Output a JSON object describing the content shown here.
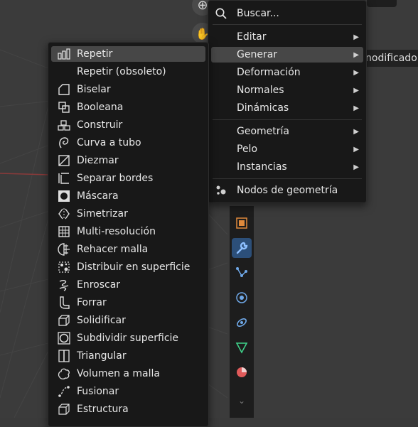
{
  "viewport": {
    "modifier_label": "nodificador"
  },
  "main_menu": {
    "search": {
      "label": "Buscar...",
      "icon": "search-icon"
    },
    "items": [
      {
        "label": "Editar",
        "submenu": true
      },
      {
        "label": "Generar",
        "submenu": true,
        "active": true
      },
      {
        "label": "Deformación",
        "submenu": true
      },
      {
        "label": "Normales",
        "submenu": true
      },
      {
        "label": "Dinámicas",
        "submenu": true
      }
    ],
    "items2": [
      {
        "label": "Geometría",
        "submenu": true
      },
      {
        "label": "Pelo",
        "submenu": true
      },
      {
        "label": "Instancias",
        "submenu": true
      }
    ],
    "nodes": {
      "label": "Nodos de geometría",
      "icon": "geometry-nodes-icon"
    }
  },
  "generate_menu": {
    "items": [
      {
        "label": "Repetir",
        "icon": "array-icon",
        "active": true
      },
      {
        "label": "Repetir (obsoleto)",
        "icon": ""
      },
      {
        "label": "Biselar",
        "icon": "bevel-icon"
      },
      {
        "label": "Booleana",
        "icon": "boolean-icon"
      },
      {
        "label": "Construir",
        "icon": "build-icon"
      },
      {
        "label": "Curva a tubo",
        "icon": "curve-to-tube-icon"
      },
      {
        "label": "Diezmar",
        "icon": "decimate-icon"
      },
      {
        "label": "Separar bordes",
        "icon": "edge-split-icon"
      },
      {
        "label": "Máscara",
        "icon": "mask-icon"
      },
      {
        "label": "Simetrizar",
        "icon": "mirror-icon"
      },
      {
        "label": "Multi-resolución",
        "icon": "multires-icon"
      },
      {
        "label": "Rehacer malla",
        "icon": "remesh-icon"
      },
      {
        "label": "Distribuir en superficie",
        "icon": "scatter-icon"
      },
      {
        "label": "Enroscar",
        "icon": "screw-icon"
      },
      {
        "label": "Forrar",
        "icon": "skin-icon"
      },
      {
        "label": "Solidificar",
        "icon": "solidify-icon"
      },
      {
        "label": "Subdividir superficie",
        "icon": "subdivision-icon"
      },
      {
        "label": "Triangular",
        "icon": "triangulate-icon"
      },
      {
        "label": "Volumen a malla",
        "icon": "volume-to-mesh-icon"
      },
      {
        "label": "Fusionar",
        "icon": "weld-icon"
      },
      {
        "label": "Estructura",
        "icon": "wireframe-icon"
      }
    ]
  },
  "properties_toolbar": {
    "tabs": [
      {
        "name": "object-icon",
        "color": "#e08a3c"
      },
      {
        "name": "wrench-icon",
        "color": "#6fa8e8",
        "active": true
      },
      {
        "name": "particles-icon",
        "color": "#6fa8e8"
      },
      {
        "name": "physics-icon",
        "color": "#6fa8e8"
      },
      {
        "name": "constraints-icon",
        "color": "#6fa8e8"
      },
      {
        "name": "data-icon",
        "color": "#3fd18a"
      },
      {
        "name": "material-icon",
        "color": "#e05a5a"
      },
      {
        "name": "chevron-down-icon",
        "color": "#888888"
      }
    ]
  },
  "colors": {
    "menu_bg": "#181818",
    "active_item": "#474747",
    "text": "#e6e6e6",
    "accent_blue": "#2c4f79"
  }
}
